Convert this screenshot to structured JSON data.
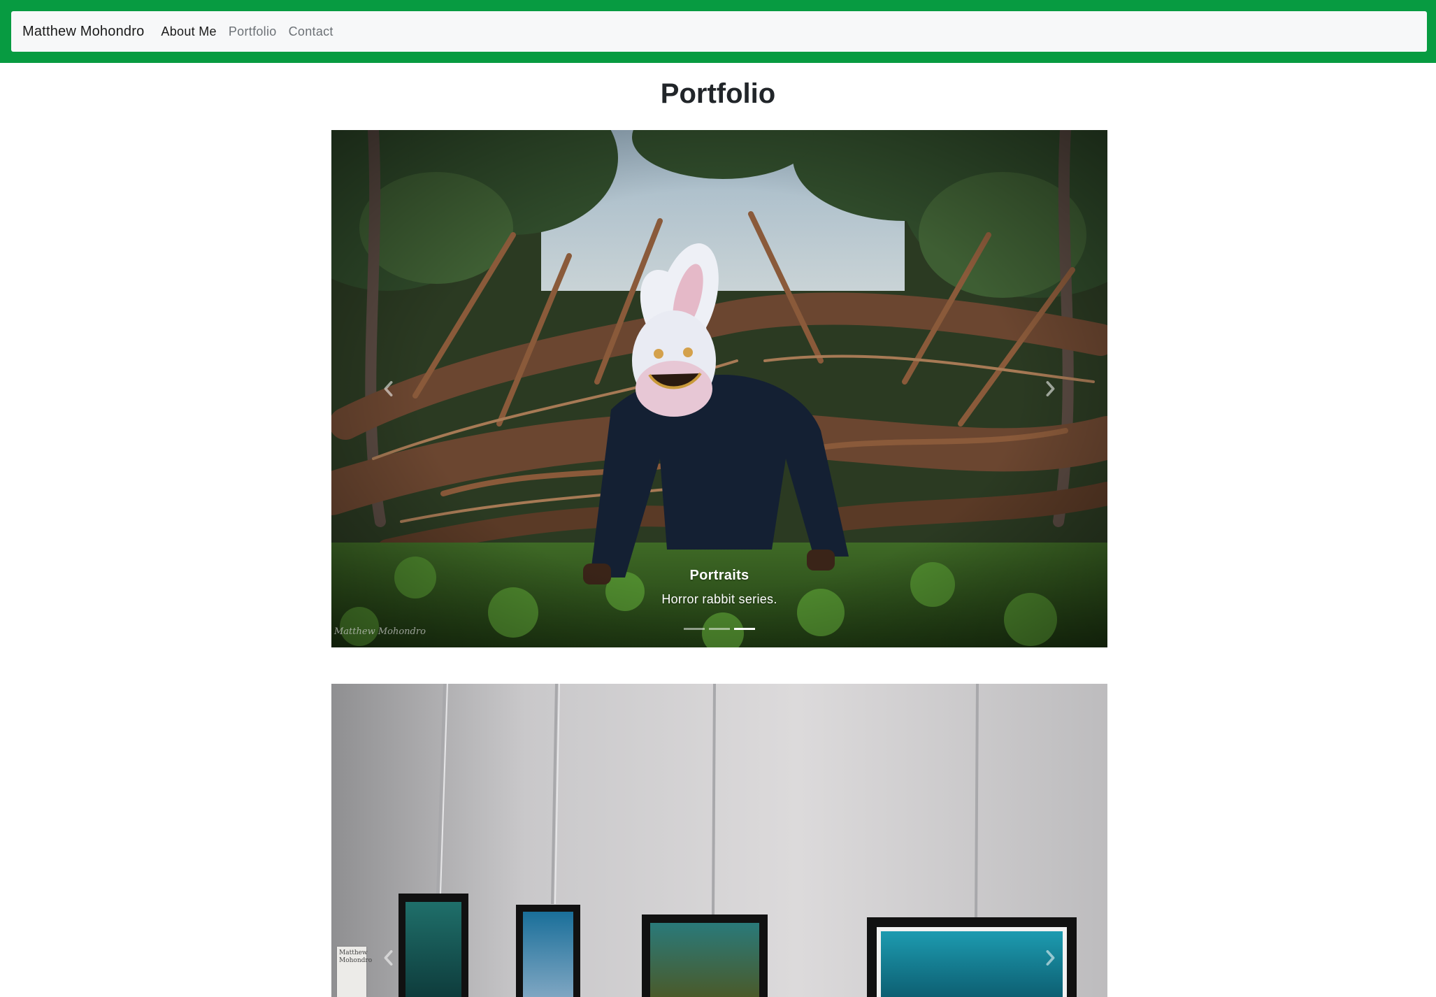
{
  "navbar": {
    "brand": "Matthew Mohondro",
    "links": [
      {
        "label": "About Me",
        "state": "active"
      },
      {
        "label": "Portfolio",
        "state": "inactive"
      },
      {
        "label": "Contact",
        "state": "inactive"
      }
    ],
    "frame_color": "#079b41",
    "bar_color": "#f7f8f9"
  },
  "page": {
    "title": "Portfolio"
  },
  "carousels": [
    {
      "caption_title": "Portraits",
      "caption_text": "Horror rabbit series.",
      "indicator_count": 3,
      "active_indicator": 3,
      "watermark": "Matthew Mohondro",
      "icons": {
        "prev": "chevron-left-icon",
        "next": "chevron-right-icon"
      }
    },
    {
      "placard_text": "Matthew Mohondro",
      "icons": {
        "prev": "chevron-left-icon",
        "next": "chevron-right-icon"
      }
    }
  ]
}
